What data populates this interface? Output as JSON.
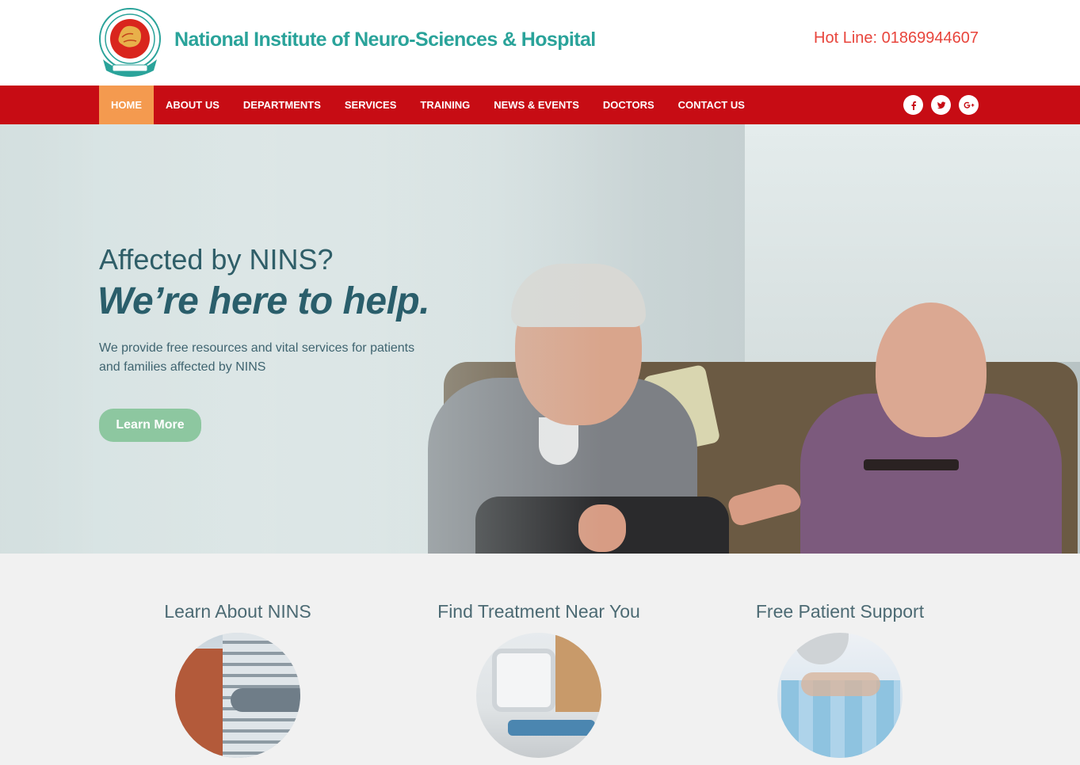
{
  "header": {
    "title": "National Institute of Neuro-Sciences & Hospital",
    "hotline": "Hot Line: 01869944607"
  },
  "nav": {
    "items": [
      "HOME",
      "ABOUT US",
      "DEPARTMENTS",
      "SERVICES",
      "TRAINING",
      "NEWS & EVENTS",
      "DOCTORS",
      "CONTACT US"
    ],
    "active": "HOME",
    "social": [
      {
        "name": "facebook-icon",
        "glyph": "f"
      },
      {
        "name": "twitter-icon",
        "glyph": "t"
      },
      {
        "name": "google-plus-icon",
        "glyph": "G+"
      }
    ]
  },
  "hero": {
    "line1": "Affected by NINS?",
    "line2": "We’re here to help.",
    "description": "We provide free resources and vital services for patients and families affected by NINS",
    "button": "Learn More"
  },
  "features": [
    {
      "title": "Learn About NINS"
    },
    {
      "title": "Find Treatment Near You"
    },
    {
      "title": "Free Patient Support"
    }
  ],
  "colors": {
    "nav_bg": "#c70c14",
    "nav_active": "#f49a4f",
    "title": "#2aa39a",
    "hotline": "#e8453c",
    "button": "#8dc7a0"
  }
}
